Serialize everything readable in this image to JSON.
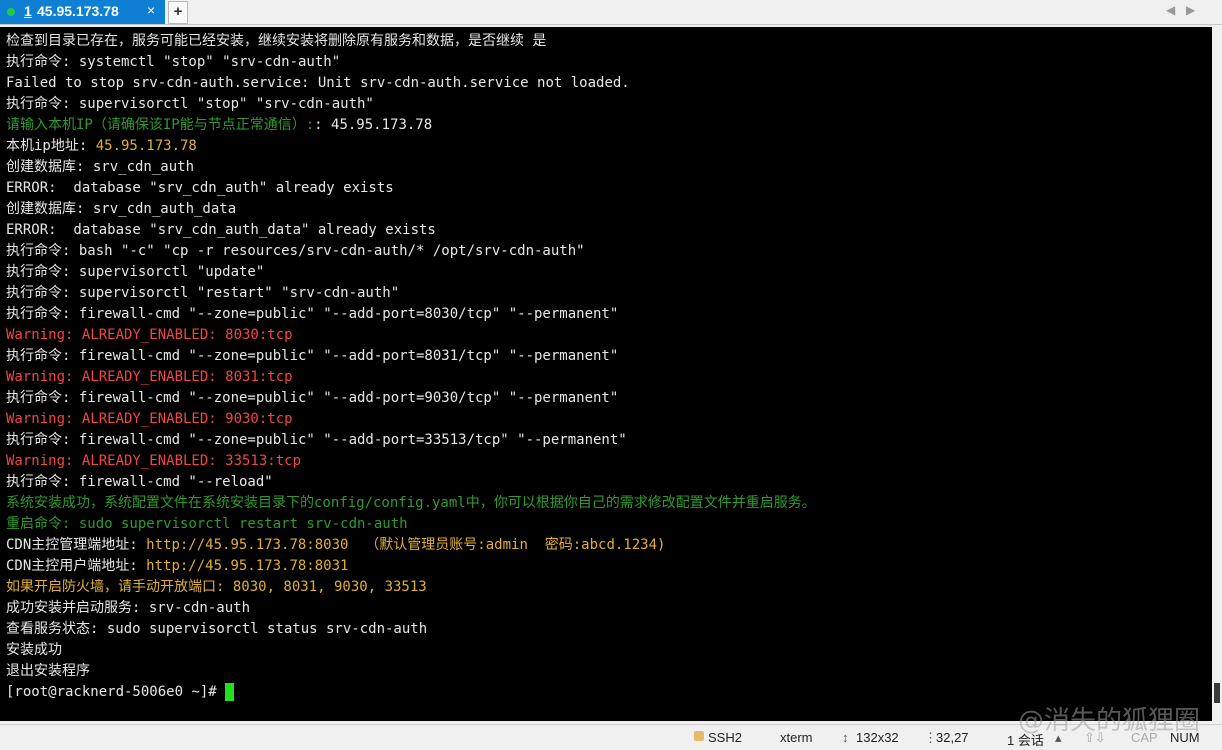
{
  "tab": {
    "number": "1",
    "title": "45.95.173.78",
    "close_label": "×",
    "new_tab_label": "+"
  },
  "nav": {
    "left": "◀",
    "right": "▶"
  },
  "terminal": {
    "lines": [
      {
        "text": "检查到目录已存在，服务可能已经安装，继续安装将删除原有服务和数据，是否继续 是",
        "color": "w"
      },
      {
        "text": "执行命令: systemctl \"stop\" \"srv-cdn-auth\"",
        "color": "w"
      },
      {
        "text": "Failed to stop srv-cdn-auth.service: Unit srv-cdn-auth.service not loaded.",
        "color": "w"
      },
      {
        "text": "执行命令: supervisorctl \"stop\" \"srv-cdn-auth\"",
        "color": "w"
      },
      {
        "text": "请输入本机IP（请确保该IP能与节点正常通信）:",
        "color": "g",
        "tail": ": 45.95.173.78",
        "tail_color": "w"
      },
      {
        "text": "本机ip地址: ",
        "color": "w",
        "tail": "45.95.173.78",
        "tail_color": "y"
      },
      {
        "text": "创建数据库: srv_cdn_auth",
        "color": "w"
      },
      {
        "text": "ERROR:  database \"srv_cdn_auth\" already exists",
        "color": "w"
      },
      {
        "text": "创建数据库: srv_cdn_auth_data",
        "color": "w"
      },
      {
        "text": "ERROR:  database \"srv_cdn_auth_data\" already exists",
        "color": "w"
      },
      {
        "text": "执行命令: bash \"-c\" \"cp -r resources/srv-cdn-auth/* /opt/srv-cdn-auth\"",
        "color": "w"
      },
      {
        "text": "执行命令: supervisorctl \"update\"",
        "color": "w"
      },
      {
        "text": "执行命令: supervisorctl \"restart\" \"srv-cdn-auth\"",
        "color": "w"
      },
      {
        "text": "执行命令: firewall-cmd \"--zone=public\" \"--add-port=8030/tcp\" \"--permanent\"",
        "color": "w"
      },
      {
        "text": "Warning: ALREADY_ENABLED: 8030:tcp",
        "color": "r"
      },
      {
        "text": "执行命令: firewall-cmd \"--zone=public\" \"--add-port=8031/tcp\" \"--permanent\"",
        "color": "w"
      },
      {
        "text": "Warning: ALREADY_ENABLED: 8031:tcp",
        "color": "r"
      },
      {
        "text": "执行命令: firewall-cmd \"--zone=public\" \"--add-port=9030/tcp\" \"--permanent\"",
        "color": "w"
      },
      {
        "text": "Warning: ALREADY_ENABLED: 9030:tcp",
        "color": "r"
      },
      {
        "text": "执行命令: firewall-cmd \"--zone=public\" \"--add-port=33513/tcp\" \"--permanent\"",
        "color": "w"
      },
      {
        "text": "Warning: ALREADY_ENABLED: 33513:tcp",
        "color": "r"
      },
      {
        "text": "执行命令: firewall-cmd \"--reload\"",
        "color": "w"
      },
      {
        "text": "系统安装成功，系统配置文件在系统安装目录下的config/config.yaml中，你可以根据你自己的需求修改配置文件并重启服务。",
        "color": "g"
      },
      {
        "text": "重启命令: sudo supervisorctl restart srv-cdn-auth",
        "color": "g"
      },
      {
        "text": "CDN主控管理端地址: ",
        "color": "w",
        "tail": "http://45.95.173.78:8030  （默认管理员账号:admin  密码:abcd.1234)",
        "tail_color": "y"
      },
      {
        "text": "CDN主控用户端地址: ",
        "color": "w",
        "tail": "http://45.95.173.78:8031",
        "tail_color": "y"
      },
      {
        "text": "如果开启防火墙，请手动开放端口: 8030, 8031, 9030, 33513",
        "color": "y"
      },
      {
        "text": "成功安装并启动服务: srv-cdn-auth",
        "color": "w"
      },
      {
        "text": "查看服务状态: sudo supervisorctl status srv-cdn-auth",
        "color": "w"
      },
      {
        "text": "安装成功",
        "color": "w"
      },
      {
        "text": "退出安装程序",
        "color": "w"
      }
    ],
    "prompt": "[root@racknerd-5006e0 ~]# "
  },
  "status": {
    "protocol": "SSH2",
    "term_type": "xterm",
    "size": "132x32",
    "cursor_pos": "32,27",
    "sessions": "1 会话",
    "cap": "CAP",
    "num": "NUM"
  },
  "watermark": "@消失的狐狸圈",
  "colors": {
    "tab_bg": "#0f7fd3",
    "green_text": "#2f9a2f",
    "red_text": "#ef4646",
    "yellow_text": "#e0b030",
    "cursor": "#21e021"
  }
}
